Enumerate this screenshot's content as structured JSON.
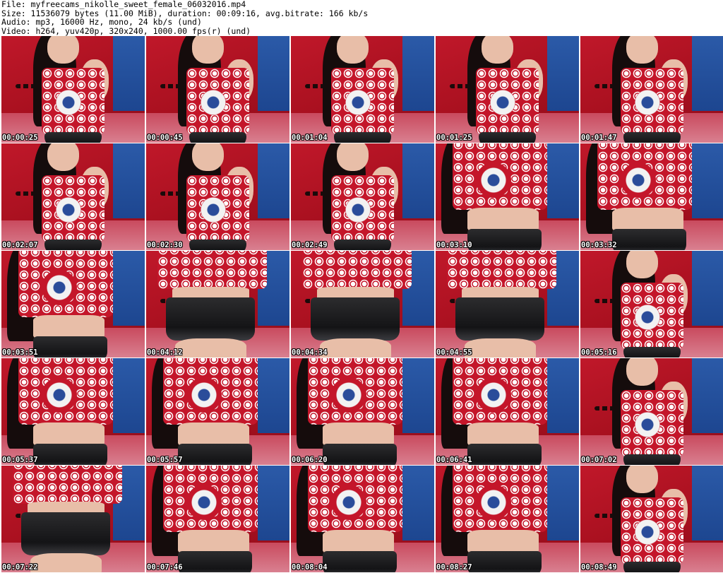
{
  "header": {
    "file": "File: myfreecams_nikolle_sweet_female_06032016.mp4",
    "size": "Size: 11536079 bytes (11.00 MiB), duration: 00:09:16, avg.bitrate: 166 kb/s",
    "audio": "Audio: mp3, 16000 Hz, mono, 24 kb/s (und)",
    "video": "Video: h264, yuv420p, 320x240, 1000.00 fps(r) (und)"
  },
  "thumbnails": [
    {
      "time": "00:00:25",
      "view": "upper"
    },
    {
      "time": "00:00:45",
      "view": "upper"
    },
    {
      "time": "00:01:04",
      "view": "upper"
    },
    {
      "time": "00:01:25",
      "view": "upper"
    },
    {
      "time": "00:01:47",
      "view": "upper"
    },
    {
      "time": "00:02:07",
      "view": "upper"
    },
    {
      "time": "00:02:30",
      "view": "upper"
    },
    {
      "time": "00:02:49",
      "view": "upper"
    },
    {
      "time": "00:03:10",
      "view": "torso"
    },
    {
      "time": "00:03:32",
      "view": "torso"
    },
    {
      "time": "00:03:51",
      "view": "torso"
    },
    {
      "time": "00:04:12",
      "view": "lower"
    },
    {
      "time": "00:04:34",
      "view": "lower"
    },
    {
      "time": "00:04:55",
      "view": "lower"
    },
    {
      "time": "00:05:16",
      "view": "upper"
    },
    {
      "time": "00:05:37",
      "view": "torso"
    },
    {
      "time": "00:05:57",
      "view": "torso"
    },
    {
      "time": "00:06:20",
      "view": "torso"
    },
    {
      "time": "00:06:41",
      "view": "torso"
    },
    {
      "time": "00:07:02",
      "view": "upper"
    },
    {
      "time": "00:07:22",
      "view": "lower"
    },
    {
      "time": "00:07:46",
      "view": "torso"
    },
    {
      "time": "00:08:04",
      "view": "torso"
    },
    {
      "time": "00:08:27",
      "view": "torso"
    },
    {
      "time": "00:08:49",
      "view": "upper"
    }
  ]
}
